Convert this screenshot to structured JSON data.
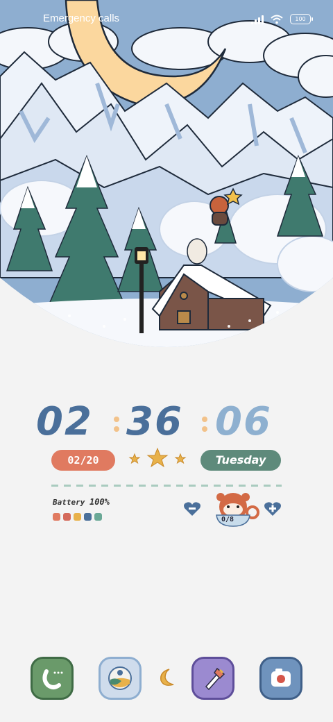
{
  "status_bar": {
    "carrier_text": "Emergency calls",
    "battery_level": "100"
  },
  "clock": {
    "hours": "02",
    "minutes": "36",
    "seconds": "06"
  },
  "date": "02/20",
  "day": "Tuesday",
  "battery_widget": {
    "label": "Battery",
    "percent": "100%"
  },
  "counter": {
    "value": "0/8"
  },
  "dock": {
    "apps": [
      "phone-app",
      "gallery-app",
      "brush-app",
      "camera-app"
    ]
  },
  "colors": {
    "clock_dark": "#4a6f9a",
    "clock_light": "#8eb0d0",
    "date_pill": "#e07a60",
    "day_pill": "#5e8a7b",
    "star": "#e8b14a",
    "phone_app": "#6a9a6a",
    "gallery_app": "#cfdcec",
    "brush_app": "#9b8ad0",
    "camera_app": "#6f93bd"
  }
}
